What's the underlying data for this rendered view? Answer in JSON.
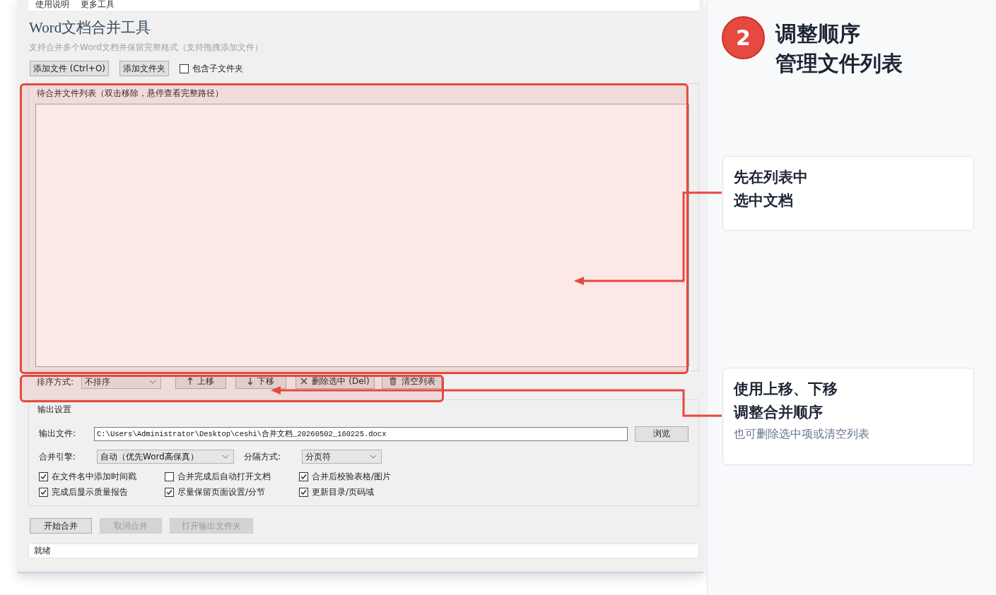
{
  "app_window": {
    "menu": [
      {
        "label": "使用说明"
      },
      {
        "label": "更多工具"
      }
    ],
    "title": "Word文档合并工具",
    "subtitle": "支持合并多个Word文档并保留完整格式（支持拖拽添加文件）",
    "toolbar": {
      "buttons": [
        {
          "label": "添加文件 (Ctrl+O)"
        },
        {
          "label": "添加文件夹"
        }
      ],
      "include_subfolders": {
        "label": "包含子文件夹",
        "checked": false
      }
    },
    "file_list": {
      "title": "待合并文件列表（双击移除，悬停查看完整路径）",
      "highlighted": true
    },
    "list_actions": {
      "sort_label": "排序方式:",
      "sort_value": "不排序",
      "buttons": [
        {
          "kind": "move-up",
          "label": "上移"
        },
        {
          "kind": "move-down",
          "label": "下移"
        },
        {
          "kind": "remove",
          "label": "删除选中 (Del)"
        },
        {
          "kind": "clear",
          "label": "清空列表"
        }
      ],
      "highlighted": true
    },
    "output_settings": {
      "title": "输出设置",
      "output_file": {
        "label": "输出文件:",
        "value": "C:\\Users\\Administrator\\Desktop\\ceshi\\合并文档_20260502_160225.docx",
        "browse": "浏览"
      },
      "engine": {
        "label": "合并引擎:",
        "value": "自动（优先Word高保真）"
      },
      "separator": {
        "label": "分隔方式:",
        "value": "分页符"
      },
      "options": [
        {
          "label": "在文件名中添加时间戳",
          "checked": true
        },
        {
          "label": "合并完成后自动打开文档",
          "checked": false
        },
        {
          "label": "合并后校验表格/图片",
          "checked": true
        },
        {
          "label": "完成后显示质量报告",
          "checked": true
        },
        {
          "label": "尽量保留页面设置/分节",
          "checked": true
        },
        {
          "label": "更新目录/页码域",
          "checked": true
        }
      ]
    },
    "actions": [
      {
        "label": "开始合并",
        "disabled": false
      },
      {
        "label": "取消合并",
        "disabled": true
      },
      {
        "label": "打开输出文件夹",
        "disabled": true
      }
    ],
    "status_bar": "就绪"
  },
  "step": {
    "number": "2",
    "title_lines": [
      "调整顺序",
      "管理文件列表"
    ]
  },
  "callouts": [
    {
      "lines": [
        "先在列表中",
        "选中文档"
      ]
    },
    {
      "lines": [
        "使用上移、下移",
        "调整合并顺序"
      ],
      "note": "也可删除选中项或清空列表"
    }
  ]
}
